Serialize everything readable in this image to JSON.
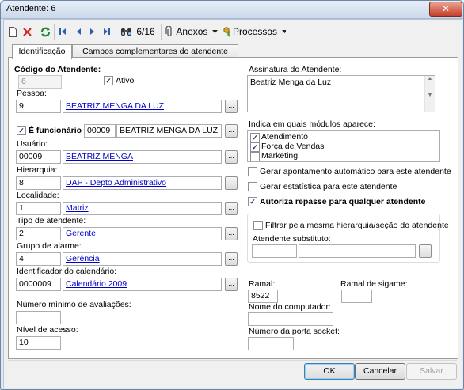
{
  "window": {
    "title": "Atendente: 6",
    "close_glyph": "✕"
  },
  "toolbar": {
    "record_counter": "6/16",
    "anexos_label": "Anexos",
    "processos_label": "Processos"
  },
  "tabs": [
    {
      "label": "Identificação"
    },
    {
      "label": "Campos complementares do atendente"
    }
  ],
  "form": {
    "codigo_label": "Código do Atendente:",
    "codigo_value": "6",
    "ativo_label": "Ativo",
    "pessoa_label": "Pessoa:",
    "pessoa_code": "9",
    "pessoa_name": "BEATRIZ MENGA DA LUZ",
    "funcionario_label": "É funcionário",
    "funcionario_code": "00009",
    "funcionario_name": "BEATRIZ MENGA DA LUZ",
    "usuario_label": "Usuário:",
    "usuario_code": "00009",
    "usuario_name": "BEATRIZ MENGA",
    "hierarquia_label": "Hierarquia:",
    "hierarquia_code": "8",
    "hierarquia_name": "DAP - Depto Administrativo",
    "localidade_label": "Localidade:",
    "localidade_code": "1",
    "localidade_name": "Matriz",
    "tipo_label": "Tipo de atendente:",
    "tipo_code": "2",
    "tipo_name": "Gerente",
    "alarme_label": "Grupo de alarme:",
    "alarme_code": "4",
    "alarme_name": "Gerência",
    "calendario_label": "Identificador do calendário:",
    "calendario_code": "0000009",
    "calendario_name": "Calendário 2009",
    "min_aval_label": "Número mínimo de avaliações:",
    "min_aval_value": "",
    "nivel_label": "Nível de acesso:",
    "nivel_value": "10",
    "dots_label": "...",
    "assinatura_label": "Assinatura do Atendente:",
    "assinatura_value": "Beatriz Menga da Luz",
    "modulos_label": "Indica em quais módulos aparece:",
    "modulos": [
      {
        "label": "Atendimento",
        "checked": true
      },
      {
        "label": "Força de Vendas",
        "checked": true
      },
      {
        "label": "Marketing",
        "checked": false
      }
    ],
    "apontamento_label": "Gerar apontamento automático para este atendente",
    "estatistica_label": "Gerar estatística para este atendente",
    "repasse_label": "Autoriza repasse para qualquer atendente",
    "filtrar_label": "Filtrar pela mesma hierarquia/seção do atendente",
    "substituto_label": "Atendente substituto:",
    "ramal_label": "Ramal:",
    "ramal_value": "8522",
    "ramal_sigame_label": "Ramal de sigame:",
    "computador_label": "Nome do computador:",
    "porta_label": "Número da porta socket:",
    "check_glyph": "✓"
  },
  "buttons": {
    "ok": "OK",
    "cancel": "Cancelar",
    "save": "Salvar"
  },
  "icons": [
    "new-icon",
    "delete-icon",
    "refresh-icon",
    "first-icon",
    "prev-icon",
    "next-icon",
    "last-icon",
    "binoculars-icon",
    "attachment-icon",
    "process-icon"
  ],
  "colors": {
    "link": "#0000cc",
    "close": "#c7402c",
    "accent": "#3c7fb1"
  }
}
